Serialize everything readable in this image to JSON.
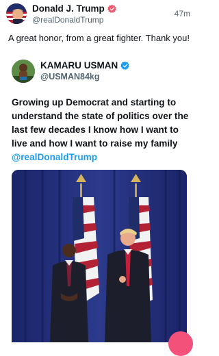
{
  "post": {
    "author_name": "Donald J. Trump",
    "author_handle": "@realDonaldTrump",
    "time": "47m",
    "text": "A great honor, from a great fighter. Thank you!"
  },
  "quote": {
    "author_name": "KAMARU USMAN",
    "author_handle": "@USMAN84kg",
    "body": "Growing up Democrat and starting to understand the state of politics over the last few decades I know how I want to live and how I want to raise my family",
    "mention": "@realDonaldTrump"
  },
  "colors": {
    "verified_badge": "#1d9bf0",
    "trump_badge": "#f05a6e",
    "mention": "#1d9bf0"
  },
  "icons": [
    "verified-badge-icon",
    "compose-fab-icon"
  ]
}
